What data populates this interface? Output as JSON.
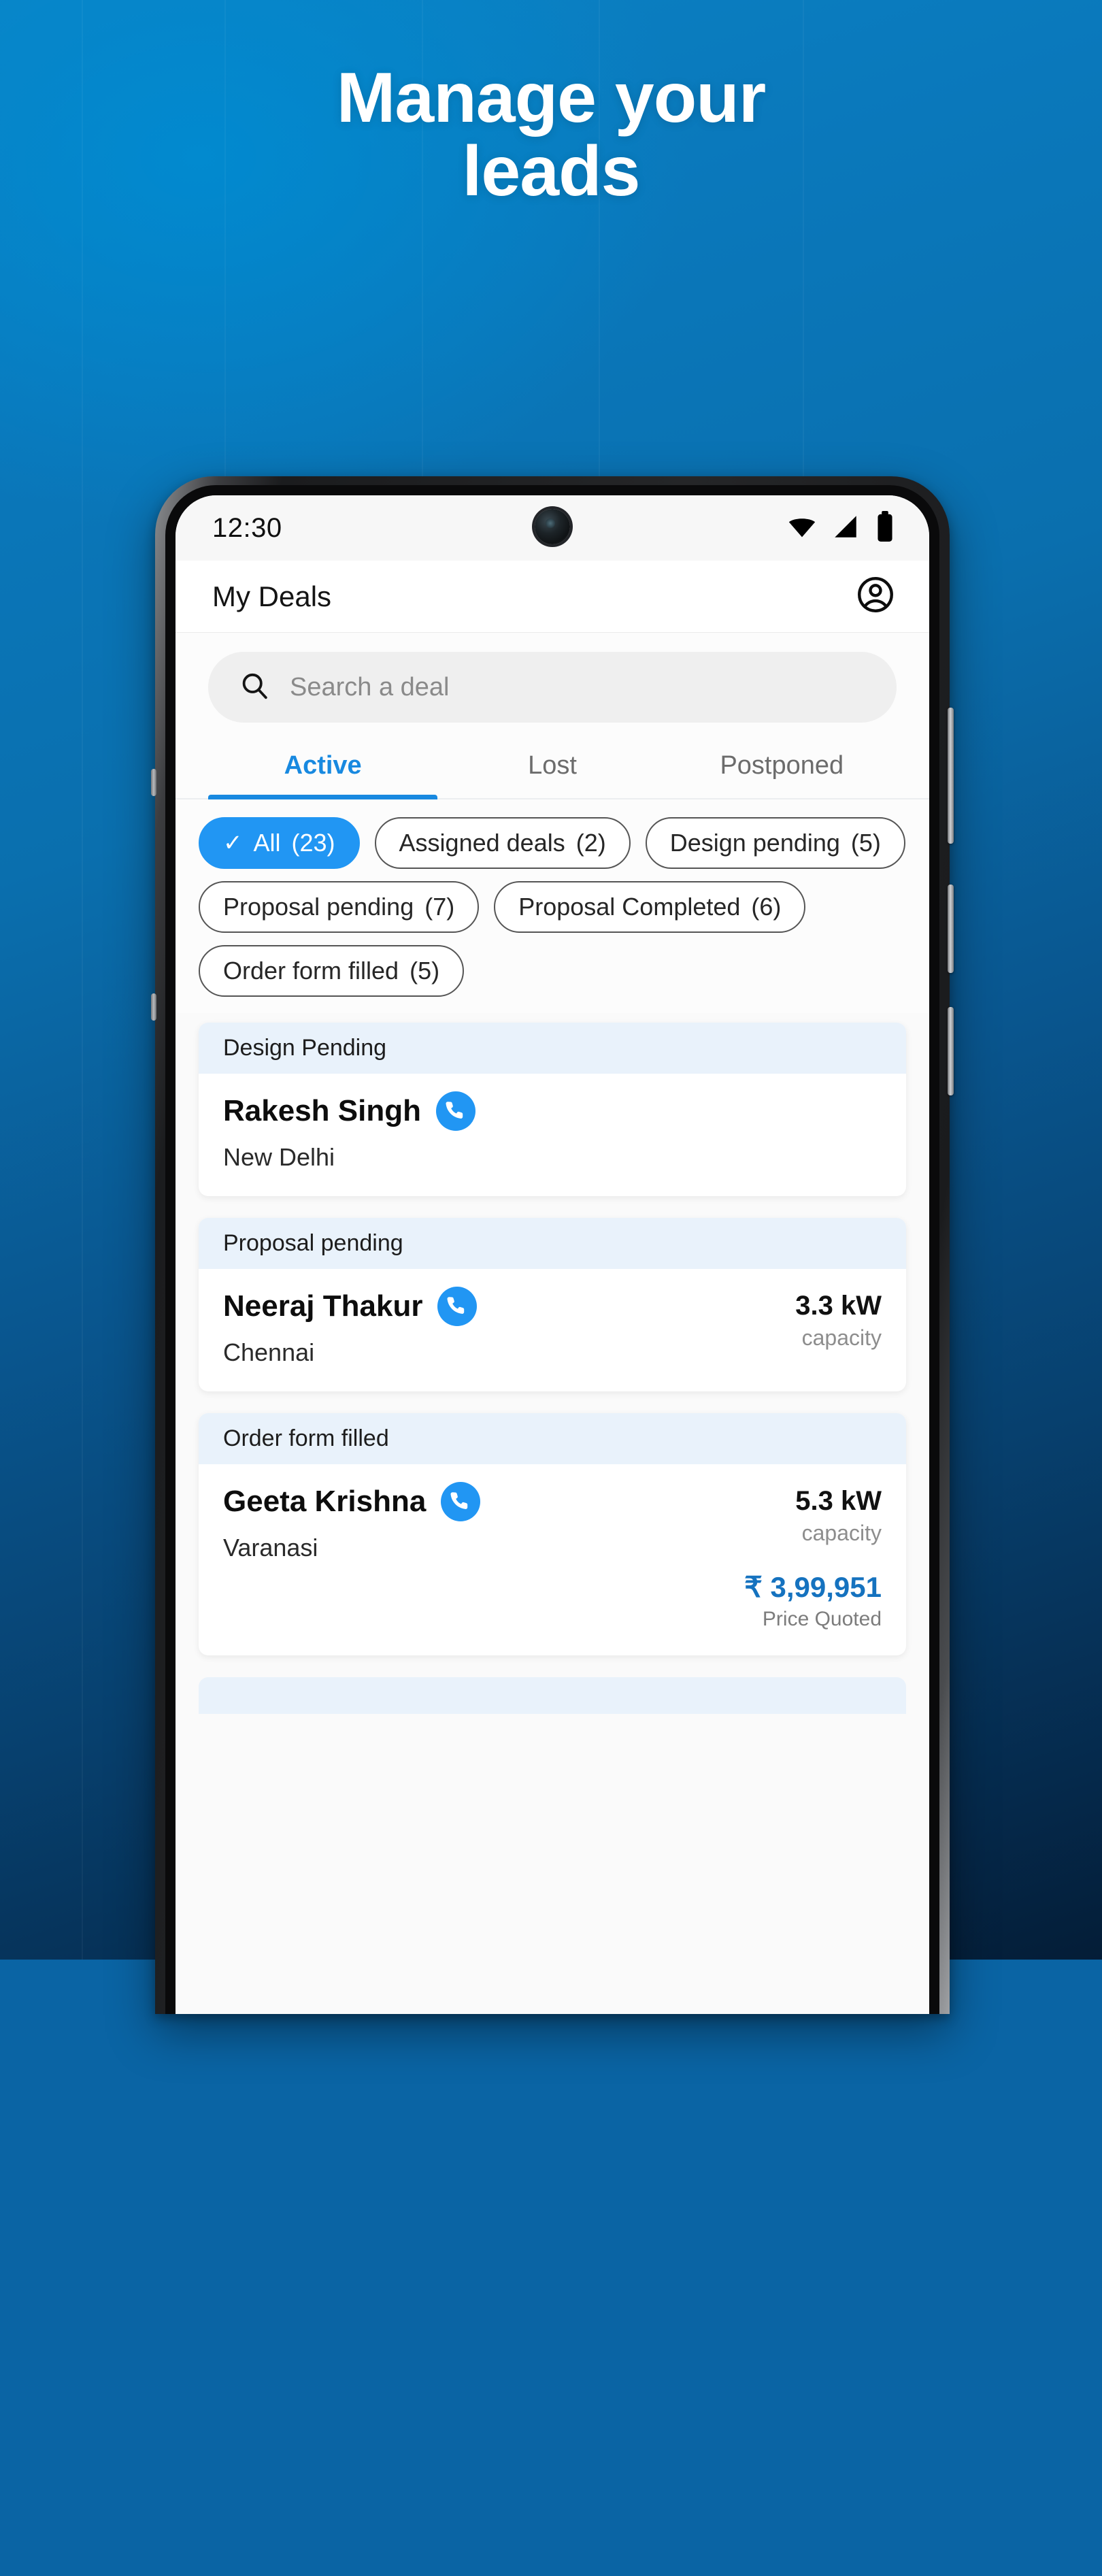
{
  "hero": {
    "headline_line1": "Manage your",
    "headline_line2": "leads"
  },
  "phone": {
    "status_bar": {
      "time": "12:30",
      "icons": [
        "wifi-icon",
        "cellular-signal-icon",
        "battery-icon"
      ]
    },
    "app_bar": {
      "title": "My Deals",
      "profile_icon": "account-circle-icon"
    },
    "search": {
      "placeholder": "Search a deal",
      "value": "",
      "icon": "search-icon"
    },
    "tabs": [
      {
        "label": "Active",
        "active": true
      },
      {
        "label": "Lost",
        "active": false
      },
      {
        "label": "Postponed",
        "active": false
      }
    ],
    "filter_chips": [
      {
        "label": "All",
        "count": "(23)",
        "selected": true,
        "check": "✓"
      },
      {
        "label": "Assigned deals",
        "count": "(2)",
        "selected": false
      },
      {
        "label": "Design pending",
        "count": "(5)",
        "selected": false
      },
      {
        "label": "Proposal pending",
        "count": "(7)",
        "selected": false
      },
      {
        "label": "Proposal Completed",
        "count": "(6)",
        "selected": false
      },
      {
        "label": "Order form filled",
        "count": "(5)",
        "selected": false
      }
    ],
    "deals": [
      {
        "status": "Design Pending",
        "name": "Rakesh Singh",
        "city": "New Delhi",
        "capacity": "",
        "capacity_label": "",
        "price": "",
        "price_label": "",
        "call_icon": "phone-call-icon"
      },
      {
        "status": "Proposal pending",
        "name": "Neeraj Thakur",
        "city": "Chennai",
        "capacity": "3.3 kW",
        "capacity_label": "capacity",
        "price": "",
        "price_label": "",
        "call_icon": "phone-call-icon"
      },
      {
        "status": "Order form filled",
        "name": "Geeta Krishna",
        "city": "Varanasi",
        "capacity": "5.3 kW",
        "capacity_label": "capacity",
        "price": "₹ 3,99,951",
        "price_label": "Price Quoted",
        "call_icon": "phone-call-icon"
      }
    ]
  },
  "colors": {
    "brand_blue": "#2196f3",
    "tab_active": "#1889e0",
    "price_blue": "#1572bf",
    "card_header_bg": "#e9f2fb",
    "bg_top": "#0b82c4",
    "bg_bottom": "#041d37"
  }
}
